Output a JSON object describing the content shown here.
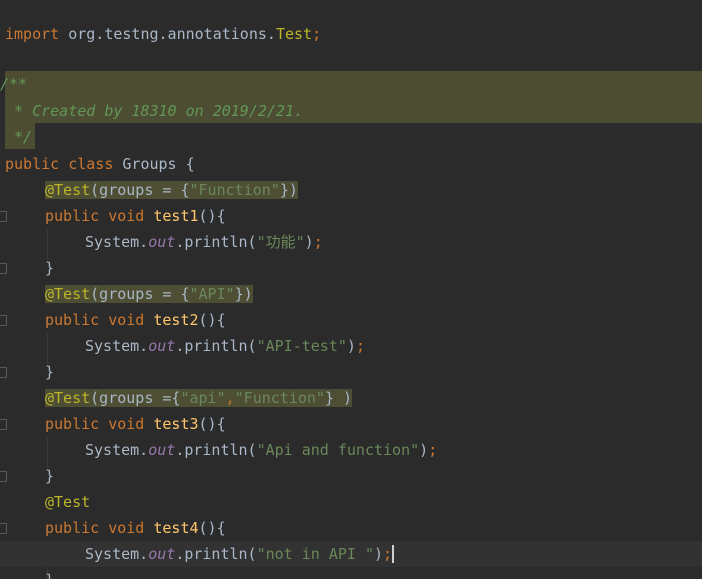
{
  "editor": {
    "import_keyword": "import",
    "import_path": "org.testng.annotations.",
    "import_class": "Test",
    "semicolon": ";",
    "doc_open": "/**",
    "doc_body": " * Created by 18310 on 2019/2/21.",
    "doc_close": " */",
    "kw_public": "public",
    "kw_class": "class",
    "class_name": "Groups",
    "brace_open": "{",
    "brace_close": "}",
    "kw_void": "void",
    "at_test": "@Test",
    "groups_prefix": "(groups = {",
    "groups_prefix_3": "(groups ={",
    "groups_suffix": "})",
    "groups_suffix_3": "} )",
    "comma": ",",
    "system": "System.",
    "out": "out",
    "println": ".println(",
    "call_close": ")",
    "parens_brace": "(){",
    "methods": [
      {
        "name": "test1",
        "groups": [
          "\"Function\""
        ],
        "print": "\"功能\""
      },
      {
        "name": "test2",
        "groups": [
          "\"API\""
        ],
        "print": "\"API-test\""
      },
      {
        "name": "test3",
        "groups": [
          "\"api\"",
          "\"Function\""
        ],
        "print": "\"Api and function\""
      },
      {
        "name": "test4",
        "groups": [],
        "print": "\"not in API \""
      }
    ]
  }
}
